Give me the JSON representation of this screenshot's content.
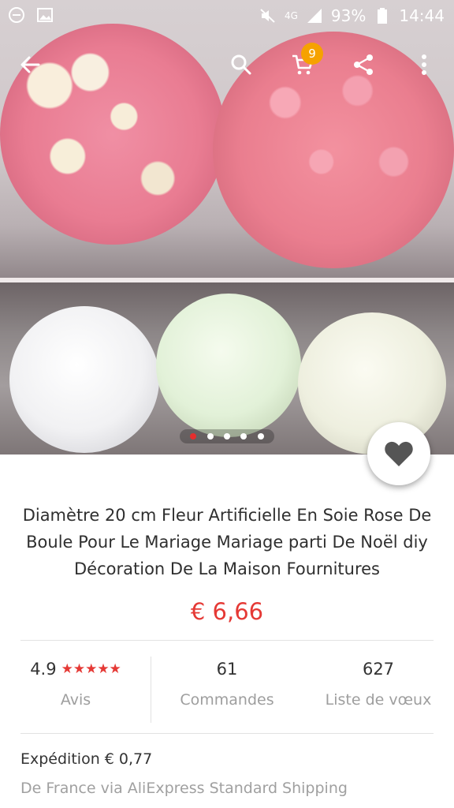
{
  "status_bar": {
    "left_icons": [
      "minus-circle-icon",
      "image-icon"
    ],
    "network": "4G",
    "battery": "93%",
    "time": "14:44"
  },
  "app_bar": {
    "cart_count": "9"
  },
  "gallery": {
    "dots_total": 5,
    "active_index": 0
  },
  "product": {
    "title": "Diamètre 20 cm Fleur Artificielle En Soie Rose De Boule Pour Le Mariage Mariage parti De Noël diy Décoration De La Maison Fournitures",
    "price": "€ 6,66"
  },
  "stats": {
    "rating_value": "4.9",
    "stars": "★★★★★",
    "rating_label": "Avis",
    "orders_value": "61",
    "orders_label": "Commandes",
    "wishlist_value": "627",
    "wishlist_label": "Liste de vœux"
  },
  "shipping": {
    "cost_text": "Expédition € 0,77",
    "method_text": "De France via AliExpress Standard Shipping"
  },
  "colors": {
    "accent_red": "#e53935",
    "badge_orange": "#f6a200"
  }
}
